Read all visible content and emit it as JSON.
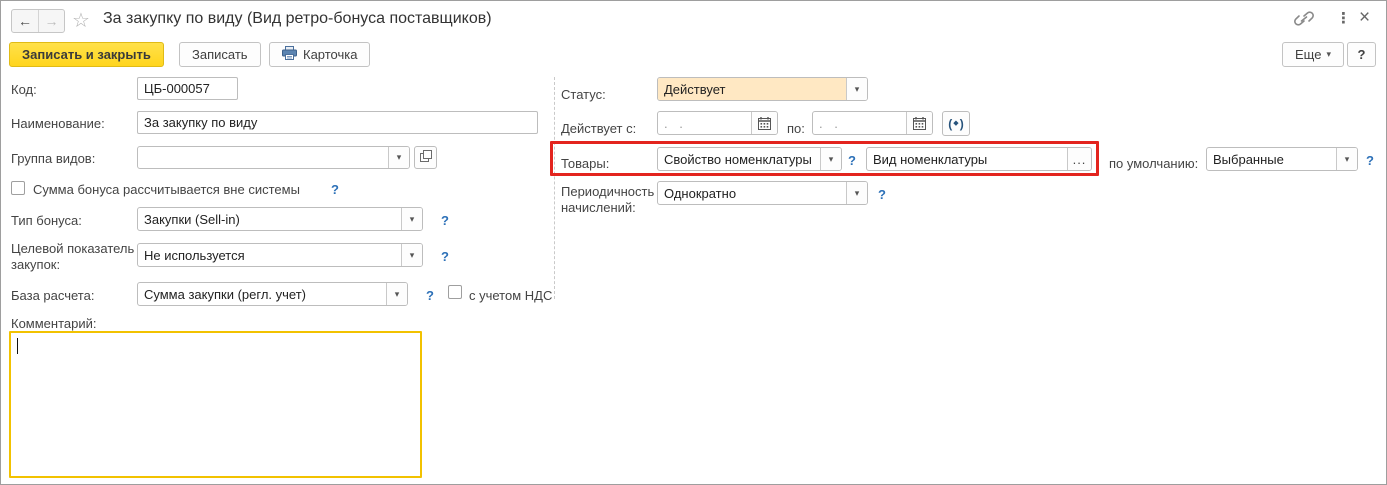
{
  "window": {
    "title": "За закупку по виду (Вид ретро-бонуса поставщиков)",
    "icons": {
      "back": "←",
      "forward": "→",
      "star": "☆",
      "dots": "⋮",
      "close": "×",
      "combo_arrow": "▾",
      "ellipsis": "...",
      "diamond": "◆"
    }
  },
  "toolbar": {
    "save_close_label": "Записать и закрыть",
    "save_label": "Записать",
    "card_label": "Карточка",
    "more_label": "Еще",
    "help_label": "?"
  },
  "form": {
    "left": {
      "code": {
        "label": "Код:",
        "value": "ЦБ-000057"
      },
      "name": {
        "label": "Наименование:",
        "value": "За закупку по виду"
      },
      "group": {
        "label": "Группа видов:",
        "value": ""
      },
      "external_bonus": {
        "label": "Сумма бонуса рассчитывается вне системы",
        "help": "?",
        "checked": false
      },
      "bonus_type": {
        "label": "Тип бонуса:",
        "value": "Закупки (Sell-in)",
        "help": "?"
      },
      "target": {
        "label": "Целевой показатель закупок:",
        "value": "Не используется",
        "help": "?"
      },
      "base": {
        "label": "База расчета:",
        "value": "Сумма закупки (регл. учет)",
        "help": "?"
      },
      "vat": {
        "label": "с учетом НДС",
        "checked": false
      },
      "comment": {
        "label": "Комментарий:",
        "value": ""
      }
    },
    "right": {
      "status": {
        "label": "Статус:",
        "value": "Действует",
        "highlight_color": "#FFE8C3"
      },
      "valid_from": {
        "label": "Действует с:",
        "value": "",
        "placeholder": ". ."
      },
      "valid_to": {
        "label": "по:",
        "value": "",
        "placeholder": ". ."
      },
      "goods": {
        "label": "Товары:",
        "selector_value": "Свойство номенклатуры",
        "help": "?",
        "value": "Вид номенклатуры",
        "highlight_border": "#E3241E"
      },
      "default": {
        "label": "по умолчанию:",
        "value": "Выбранные",
        "help": "?"
      },
      "periodicity": {
        "label": "Периодичность начислений:",
        "value": "Однократно",
        "help": "?"
      }
    }
  }
}
